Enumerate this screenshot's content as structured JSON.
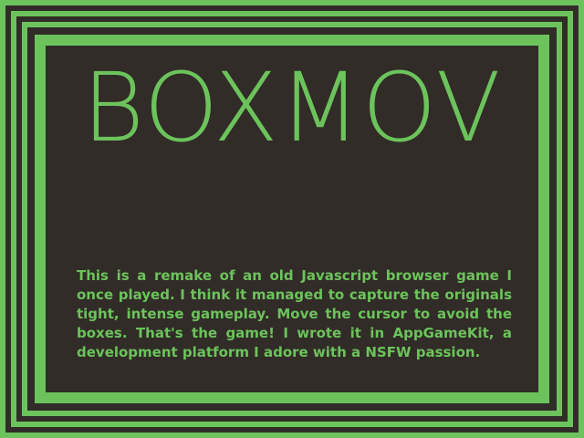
{
  "colors": {
    "background": "#312c27",
    "green": "#6cc35c",
    "text": "#6cc35c"
  },
  "title": "BOXMOV",
  "description": "This is a remake of an old Javascript browser game I once played.  I think it managed to capture the originals tight, intense gameplay. Move the cursor to avoid the boxes. That's the game! I wrote it in AppGameKit, a development platform I adore with a NSFW passion."
}
